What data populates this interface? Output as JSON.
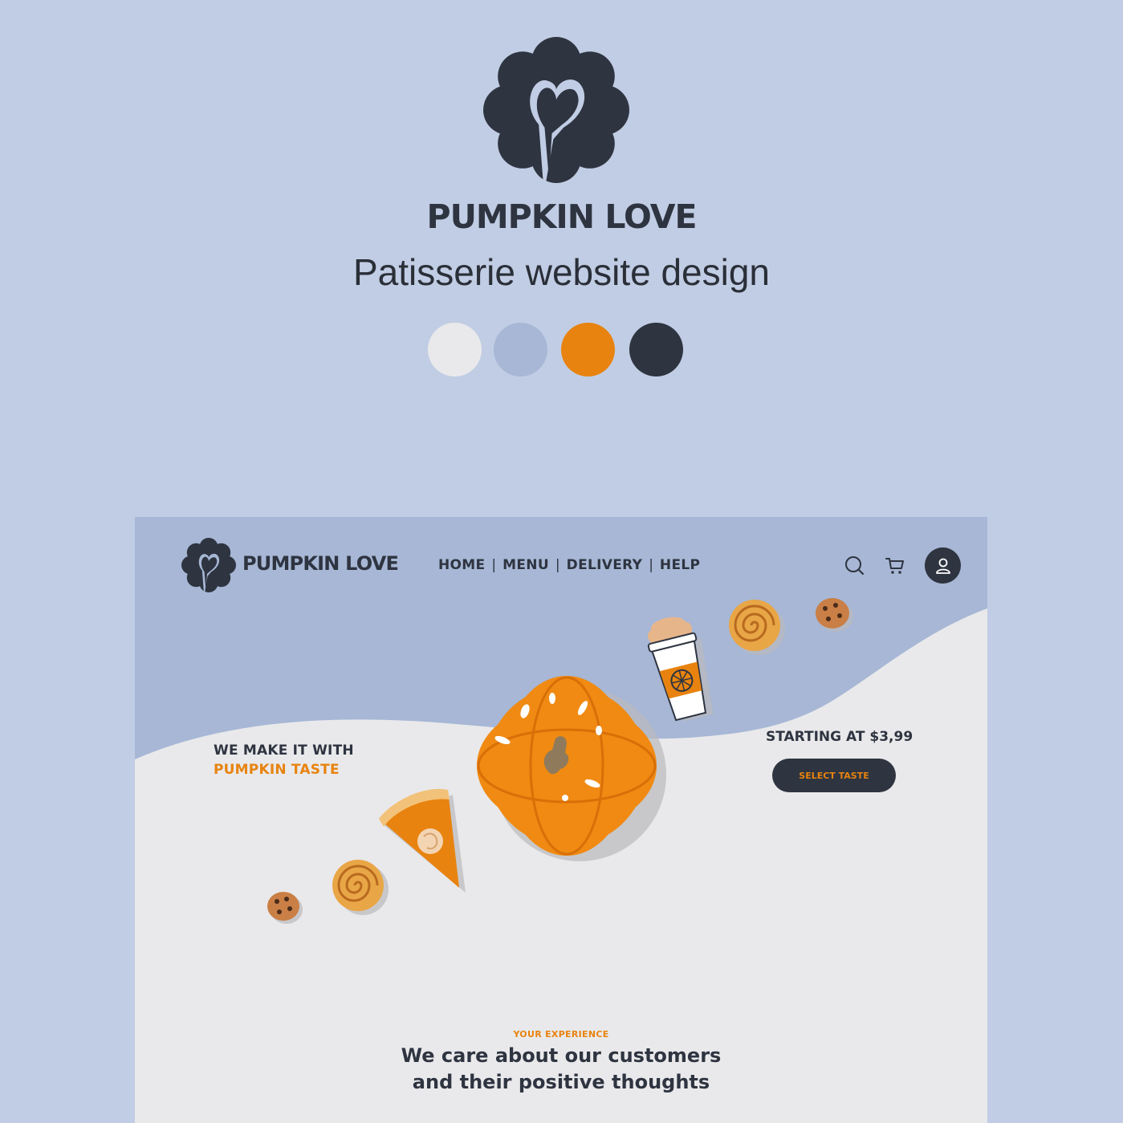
{
  "presentation": {
    "brand_name": "PUMPKIN LOVE",
    "subtitle": "Patisserie website design",
    "palette": [
      "#e9e9eb",
      "#a7b7d5",
      "#e8830f",
      "#2e3440"
    ]
  },
  "site": {
    "brand_name": "PUMPKIN LOVE",
    "nav": {
      "links": [
        "HOME",
        "MENU",
        "DELIVERY",
        "HELP"
      ],
      "icons": [
        "search-icon",
        "cart-icon",
        "user-icon"
      ]
    },
    "hero": {
      "line1": "WE MAKE IT WITH",
      "line2": "PUMPKIN TASTE",
      "price": "STARTING AT $3,99",
      "cta": "SELECT TASTE"
    },
    "illustrations": [
      "cookie",
      "cinnamon-roll",
      "pumpkin-pie-slice",
      "pumpkin",
      "pumpkin-latte-cup",
      "cinnamon-roll",
      "cookie"
    ],
    "section": {
      "kicker": "YOUR EXPERIENCE",
      "title_line1": "We care about our customers",
      "title_line2": "and their positive thoughts"
    }
  },
  "colors": {
    "page_bg": "#c1cde4",
    "header_blue": "#a7b7d5",
    "light_gray": "#e9e9eb",
    "accent_orange": "#e8830f",
    "dark": "#2e3440"
  }
}
